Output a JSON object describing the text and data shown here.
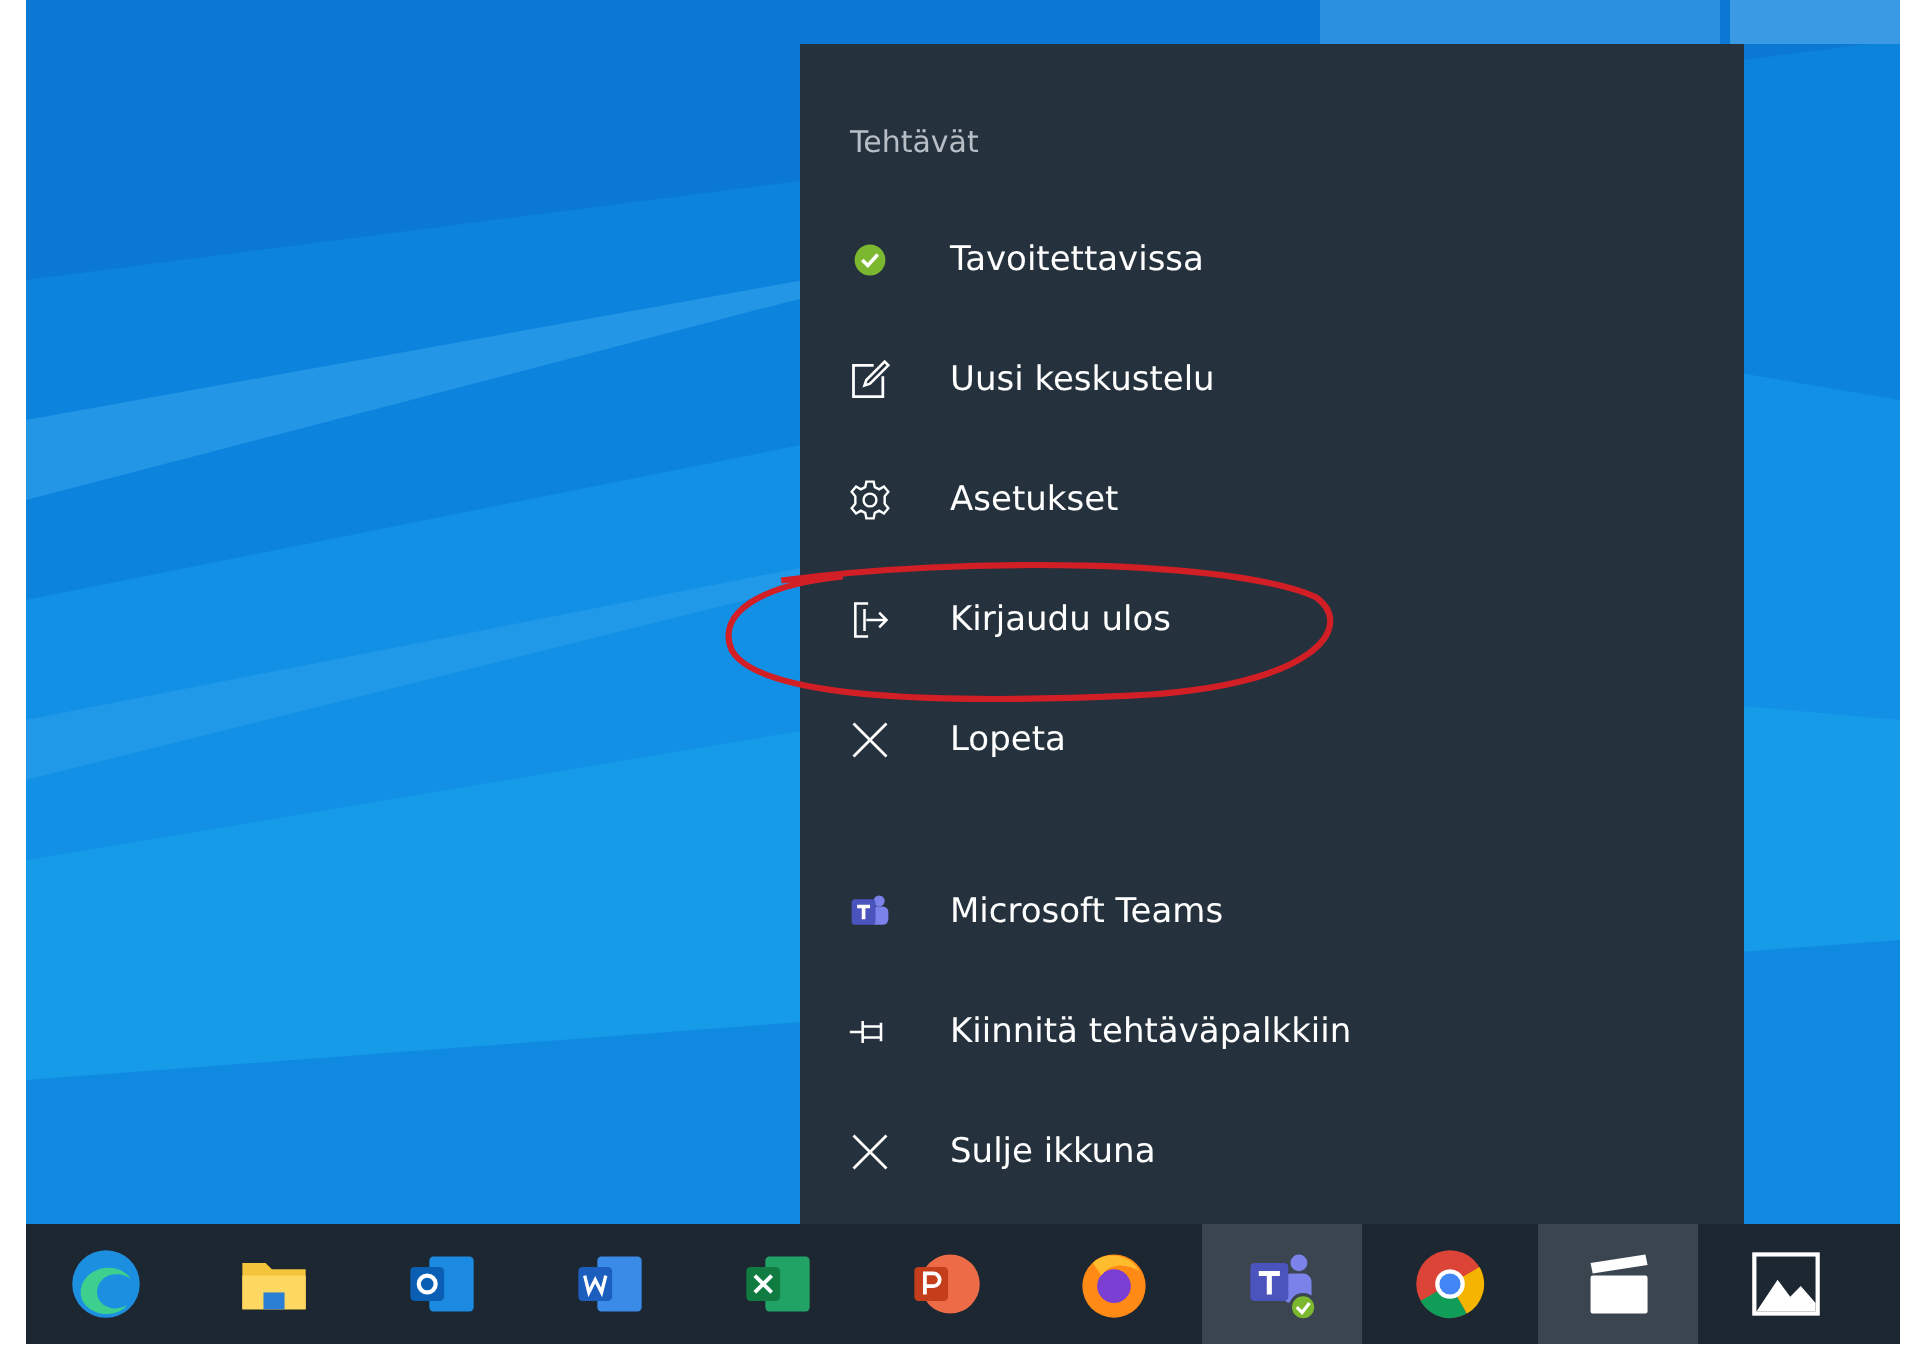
{
  "jump_list": {
    "header": "Tehtävät",
    "items": [
      {
        "kind": "status",
        "label": "Tavoitettavissa"
      },
      {
        "kind": "compose",
        "label": "Uusi keskustelu"
      },
      {
        "kind": "settings",
        "label": "Asetukset"
      },
      {
        "kind": "signout",
        "label": "Kirjaudu ulos",
        "circled": true
      },
      {
        "kind": "quit",
        "label": "Lopeta"
      }
    ],
    "app_items": [
      {
        "kind": "teams",
        "label": "Microsoft Teams"
      },
      {
        "kind": "pin",
        "label": "Kiinnitä tehtäväpalkkiin"
      },
      {
        "kind": "quit",
        "label": "Sulje ikkuna"
      }
    ]
  },
  "taskbar": {
    "apps": [
      {
        "kind": "edge",
        "highlighted": false
      },
      {
        "kind": "folder",
        "highlighted": false
      },
      {
        "kind": "outlook",
        "highlighted": false
      },
      {
        "kind": "word",
        "highlighted": false
      },
      {
        "kind": "excel",
        "highlighted": false
      },
      {
        "kind": "powerpoint",
        "highlighted": false
      },
      {
        "kind": "firefox",
        "highlighted": false
      },
      {
        "kind": "teams",
        "highlighted": true
      },
      {
        "kind": "chrome",
        "highlighted": false
      },
      {
        "kind": "clapper",
        "highlighted": true
      },
      {
        "kind": "photos",
        "highlighted": false
      }
    ]
  }
}
